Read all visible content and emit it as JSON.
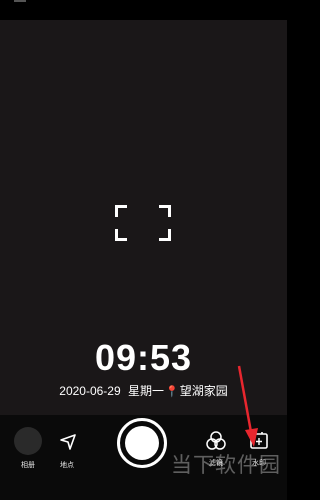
{
  "time": "09:53",
  "date": "2020-06-29",
  "weekday": "星期一",
  "location": "望湖家园",
  "toolbar": {
    "album_label": "相册",
    "location_label": "地点",
    "filter_label": "滤镜",
    "watermark_label": "水印"
  },
  "brand_watermark": "当下软件园",
  "colors": {
    "viewfinder": "#1a1718",
    "pin": "#e2303a",
    "arrow": "#e8262e"
  }
}
